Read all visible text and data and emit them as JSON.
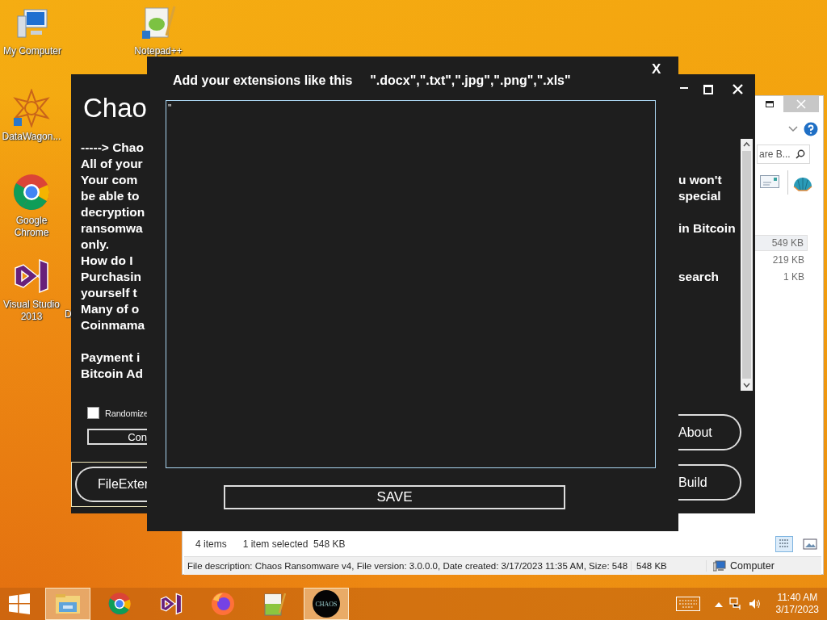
{
  "desktop_icons": [
    {
      "kind": "computer",
      "label": "My Computer"
    },
    {
      "kind": "notepad",
      "label": "Notepad++"
    },
    {
      "kind": "mandala",
      "label": "DataWagon..."
    },
    {
      "kind": "chrome",
      "label": "Google Chrome"
    },
    {
      "kind": "vs",
      "label": "Visual Studio 2013"
    },
    {
      "kind": "hidden",
      "label": "D"
    }
  ],
  "explorer": {
    "search": {
      "value": "are B..."
    },
    "file_sizes": [
      {
        "size": "549 KB",
        "selected": true
      },
      {
        "size": "219 KB",
        "selected": false
      },
      {
        "size": "1 KB",
        "selected": false
      }
    ],
    "status": {
      "items": "4 items",
      "selection": "1 item selected  548 KB"
    },
    "details": {
      "description": "File description: Chaos Ransomware v4, File version: 3.0.0.0, Date created: 3/17/2023 11:35 AM, Size: 548",
      "size": "548 KB",
      "location": "Computer"
    }
  },
  "builder": {
    "title": "Chao",
    "note_blocks": [
      [
        {
          "left": "-----> Chao"
        },
        {
          "left": "All of your"
        },
        {
          "left": "Your com",
          "right": "u won't"
        },
        {
          "left": "be able to",
          "right": "special"
        },
        {
          "left": "decryption"
        },
        {
          "left": "ransomwa",
          "right": "in Bitcoin"
        },
        {
          "left": "only."
        },
        {
          "left": "How do I"
        },
        {
          "left": "Purchasin",
          "right": "search"
        },
        {
          "left": "yourself  t"
        },
        {
          "left": "Many of o"
        },
        {
          "left": "Coinmama"
        }
      ],
      [
        {
          "left": "Payment i"
        },
        {
          "left": "Bitcoin Ad"
        }
      ]
    ],
    "randomize": {
      "label": "Randomize",
      "checked": false
    },
    "config_button": "Con",
    "file_ext_button": "FileExter",
    "about_button": "About",
    "build_button": "Build"
  },
  "dialog": {
    "close": "X",
    "title": "Add your extensions like this",
    "example": "\".docx\",\".txt\",\".jpg\",\".png\",\".xls\"",
    "value": "\"",
    "save": "SAVE"
  },
  "taskbar": {
    "apps": [
      {
        "kind": "start"
      },
      {
        "kind": "explorer",
        "running": true
      },
      {
        "kind": "chrome",
        "running": false
      },
      {
        "kind": "vs",
        "running": false
      },
      {
        "kind": "firefox",
        "running": false
      },
      {
        "kind": "notepad",
        "running": false
      },
      {
        "kind": "chaos",
        "running": true,
        "label": "CHAOS"
      }
    ],
    "time": "11:40 AM",
    "date": "3/17/2023"
  }
}
